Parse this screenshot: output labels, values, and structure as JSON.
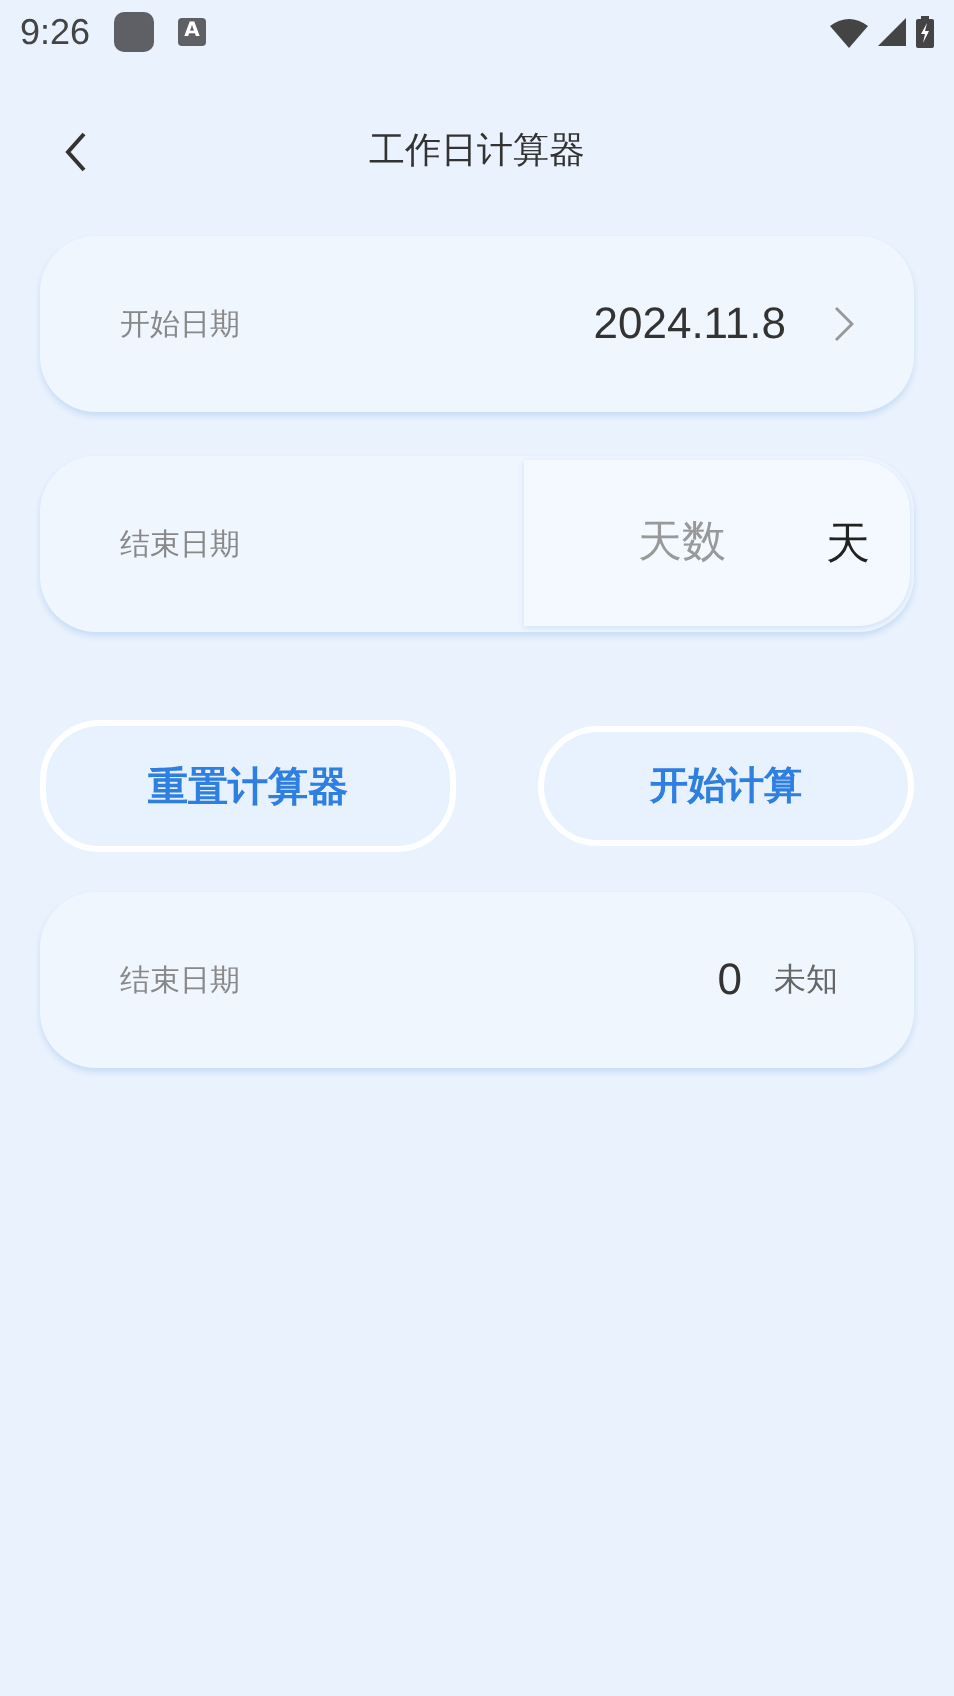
{
  "status_bar": {
    "time": "9:26",
    "notification_glyph": "A"
  },
  "header": {
    "title": "工作日计算器"
  },
  "start_row": {
    "label": "开始日期",
    "value": "2024.11.8"
  },
  "end_row": {
    "label": "结束日期",
    "placeholder": "天数",
    "unit": "天"
  },
  "buttons": [
    {
      "label": "重置计算器",
      "kind": "outline-large"
    },
    {
      "label": "开始计算",
      "kind": "outline"
    }
  ],
  "result_row": {
    "label": "结束日期",
    "value": "0",
    "note": "未知"
  }
}
